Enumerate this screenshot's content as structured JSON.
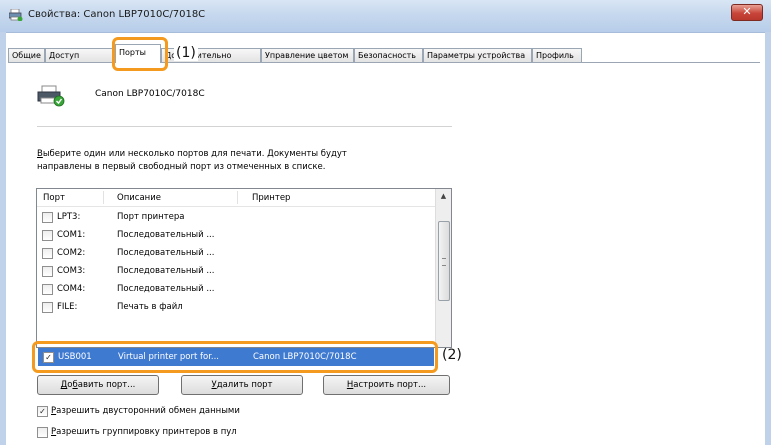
{
  "window": {
    "title": "Свойства: Canon LBP7010C/7018C",
    "close_glyph": "✕"
  },
  "tabs": [
    "Общие",
    "Доступ",
    "Порты",
    "Дополнительно",
    "Управление цветом",
    "Безопасность",
    "Параметры устройства",
    "Профиль"
  ],
  "callouts": {
    "tab": "(1)",
    "row": "(2)"
  },
  "printer": {
    "name": "Canon LBP7010C/7018C"
  },
  "description": {
    "line1_accel": "В",
    "line1_rest": "ыберите один или несколько портов для печати. Документы будут",
    "line2": "направлены в первый свободный порт из отмеченных в списке."
  },
  "ports_table": {
    "columns": [
      "Порт",
      "Описание",
      "Принтер"
    ],
    "rows": [
      {
        "port": "LPT3:",
        "description": "Порт принтера",
        "printer": "",
        "checked": false
      },
      {
        "port": "COM1:",
        "description": "Последовательный ...",
        "printer": "",
        "checked": false
      },
      {
        "port": "COM2:",
        "description": "Последовательный ...",
        "printer": "",
        "checked": false
      },
      {
        "port": "COM3:",
        "description": "Последовательный ...",
        "printer": "",
        "checked": false
      },
      {
        "port": "COM4:",
        "description": "Последовательный ...",
        "printer": "",
        "checked": false
      },
      {
        "port": "FILE:",
        "description": "Печать в файл",
        "printer": "",
        "checked": false
      }
    ],
    "selected_row": {
      "port": "USB001",
      "description": "Virtual printer port for...",
      "printer": "Canon LBP7010C/7018C",
      "checked": true
    },
    "check_glyph": "✓"
  },
  "buttons": {
    "add_accel": "Д",
    "add_mid": "о",
    "add_accel2": "б",
    "add_rest": "авить порт...",
    "delete_accel": "У",
    "delete_rest": "далить порт",
    "configure_accel": "Н",
    "configure_rest": "астроить порт..."
  },
  "options": {
    "bidirectional_accel": "Р",
    "bidirectional_rest": "азрешить двусторонний обмен данными",
    "bidirectional_checked": true,
    "pooling_accel": "Р",
    "pooling_rest": "азрешить группировку принтеров в пул",
    "pooling_checked": false
  },
  "colors": {
    "accent": "#f39a1f",
    "selection": "#3f7ad1"
  }
}
